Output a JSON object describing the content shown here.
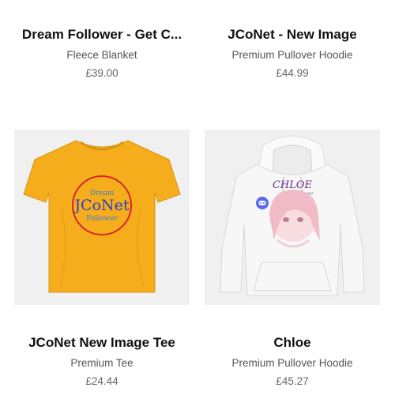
{
  "products": [
    {
      "title": "Dream Follower - Get C...",
      "type": "Fleece Blanket",
      "price": "£39.00"
    },
    {
      "title": "JCoNet - New Image",
      "type": "Premium Pullover Hoodie",
      "price": "£44.99"
    },
    {
      "title": "JCoNet New Image Tee",
      "type": "Premium Tee",
      "price": "£24.44",
      "image": {
        "shirt_color": "#f5ad1c",
        "logo_text": "JCoNet",
        "logo_small_top": "Dream",
        "logo_small_bottom": "Follower",
        "logo_ring_color": "#d7262e"
      }
    },
    {
      "title": "Chloe",
      "type": "Premium Pullover Hoodie",
      "price": "£45.27",
      "image": {
        "hoodie_color": "#f7f7f7",
        "art_title": "CHLOE",
        "art_byline": "by JesNet",
        "discord_color": "#5865f2"
      }
    }
  ]
}
